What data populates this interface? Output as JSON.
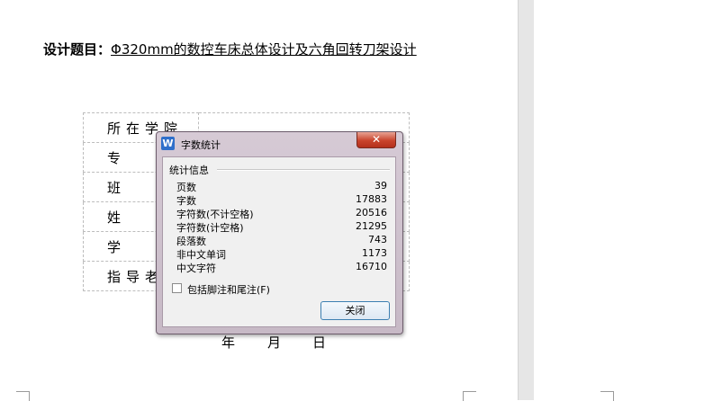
{
  "document": {
    "title_label": "设计题目：",
    "title_topic": "Φ320mm的数控车床总体设计及六角回转刀架设计",
    "table_rows": [
      "所在学院",
      "专",
      "班",
      "姓",
      "学",
      "指导老"
    ],
    "date": {
      "year": "年",
      "month": "月",
      "day": "日"
    }
  },
  "dialog": {
    "title": "字数统计",
    "app_icon_letter": "W",
    "close_glyph": "✕",
    "group_title": "统计信息",
    "stats": [
      {
        "label": "页数",
        "value": "39"
      },
      {
        "label": "字数",
        "value": "17883"
      },
      {
        "label": "字符数(不计空格)",
        "value": "20516"
      },
      {
        "label": "字符数(计空格)",
        "value": "21295"
      },
      {
        "label": "段落数",
        "value": "743"
      },
      {
        "label": "非中文单词",
        "value": "1173"
      },
      {
        "label": "中文字符",
        "value": "16710"
      }
    ],
    "checkbox_label": "包括脚注和尾注(F)",
    "close_button": "关闭"
  }
}
